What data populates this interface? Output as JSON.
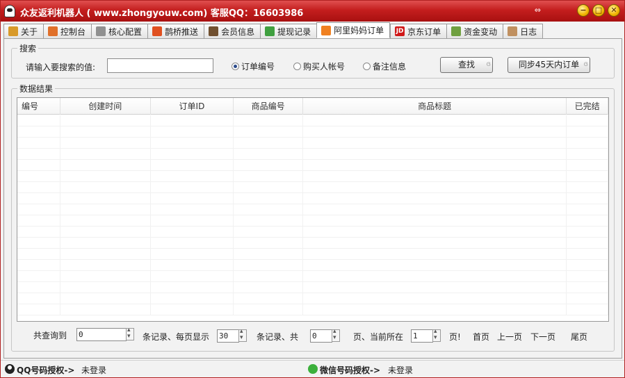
{
  "window": {
    "title": "众友返利机器人 ( www.zhongyouw.com) 客服QQ：16603986",
    "arrows": "⇔"
  },
  "tabs": [
    {
      "label": "关于",
      "icon": "home-icon",
      "color": "#d89a2a"
    },
    {
      "label": "控制台",
      "icon": "shield-icon",
      "color": "#e0702a"
    },
    {
      "label": "核心配置",
      "icon": "gear-icon",
      "color": "#909090"
    },
    {
      "label": "鹊桥推送",
      "icon": "alarm-icon",
      "color": "#e05020"
    },
    {
      "label": "会员信息",
      "icon": "users-icon",
      "color": "#705030"
    },
    {
      "label": "提现记录",
      "icon": "check-icon",
      "color": "#40a040"
    },
    {
      "label": "阿里妈妈订单",
      "icon": "alimama-icon",
      "color": "#f08020",
      "active": true
    },
    {
      "label": "京东订单",
      "icon": "jd-icon",
      "color": "#d01818",
      "glyph": "JD"
    },
    {
      "label": "资金变动",
      "icon": "money-icon",
      "color": "#70a040"
    },
    {
      "label": "日志",
      "icon": "log-icon",
      "color": "#c09060"
    }
  ],
  "search": {
    "group_label": "搜索",
    "prompt": "请输入要搜索的值:",
    "value": "",
    "options": [
      "订单编号",
      "购买人帐号",
      "备注信息"
    ],
    "selected": "订单编号",
    "find_button": "查找",
    "sync_button": "同步45天内订单"
  },
  "results": {
    "group_label": "数据结果",
    "columns": [
      "编号",
      "创建时间",
      "订单ID",
      "商品编号",
      "商品标题",
      "已完结"
    ],
    "rows": []
  },
  "pager": {
    "total_label": "共查询到",
    "total_value": "0",
    "records_per_page_label": "条记录、每页显示",
    "per_page_value": "30",
    "records_total_label": "条记录、共",
    "pages_value": "0",
    "current_page_label": "页、当前所在",
    "current_page_value": "1",
    "page_suffix": "页!",
    "first": "首页",
    "prev": "上一页",
    "next": "下一页",
    "last": "尾页"
  },
  "status": {
    "qq_label": "QQ号码授权->",
    "qq_value": "未登录",
    "wechat_label": "微信号码授权->",
    "wechat_value": "未登录"
  }
}
